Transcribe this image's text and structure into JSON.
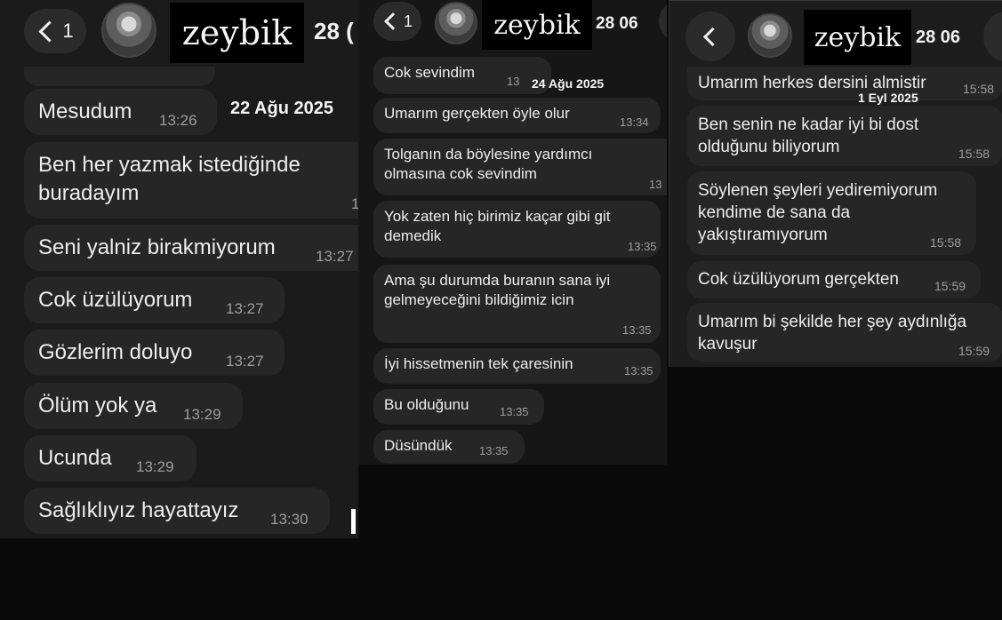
{
  "contact_name": "zeybik",
  "screens": [
    {
      "back_count": "1",
      "header_date": "28 (",
      "date_chip": "22 Ağu 2025",
      "messages": [
        {
          "text": "Mesudum",
          "time": "13:26"
        },
        {
          "text": "Ben her yazmak istediğinde\nburadayım",
          "time": "1"
        },
        {
          "text": "Seni yalniz birakmiyorum",
          "time": "13:27"
        },
        {
          "text": "Cok üzülüyorum",
          "time": "13:27"
        },
        {
          "text": "Gözlerim doluyo",
          "time": "13:27"
        },
        {
          "text": "Ölüm yok ya",
          "time": "13:29"
        },
        {
          "text": "Ucunda",
          "time": "13:29"
        },
        {
          "text": "Sağlıklıyız hayattayız",
          "time": "13:30"
        }
      ]
    },
    {
      "back_count": "1",
      "header_date": "28 06",
      "date_chip": "24 Ağu 2025",
      "messages": [
        {
          "text": "Cok sevindim",
          "time": "13"
        },
        {
          "text": "Umarım gerçekten öyle olur",
          "time": "13:34"
        },
        {
          "text": "Tolganın da böylesine yardımcı\nolmasına cok sevindim",
          "time": "13"
        },
        {
          "text": "Yok zaten hiç birimiz kaçar gibi git\ndemedik",
          "time": "13:35"
        },
        {
          "text": "Ama şu durumda buranın sana iyi\ngelmeyeceğini bildiğimiz icin",
          "time": "13:35"
        },
        {
          "text": "İyi hissetmenin tek çaresinin",
          "time": "13:35"
        },
        {
          "text": "Bu olduğunu",
          "time": "13:35"
        },
        {
          "text": "Düsündük",
          "time": "13:35"
        }
      ]
    },
    {
      "header_date": "28 06",
      "date_chip": "1 Eyl 2025",
      "messages": [
        {
          "text": "Umarım herkes dersini almistir",
          "time": "15:58"
        },
        {
          "text": "Ben senin ne kadar iyi bi dost\nolduğunu biliyorum",
          "time": "15:58"
        },
        {
          "text": "Söylenen şeyleri yediremiyorum\nkendime de sana da\nyakıştıramıyorum",
          "time": "15:58"
        },
        {
          "text": "Cok üzülüyorum gerçekten",
          "time": "15:59"
        },
        {
          "text": "Umarım bi şekilde her şey aydınlığa\nkavuşur",
          "time": "15:59"
        }
      ]
    }
  ],
  "colors": {
    "background": "#0a0a0a",
    "bubble": "#262626",
    "text": "#ededed",
    "time": "#9e9e9e"
  }
}
